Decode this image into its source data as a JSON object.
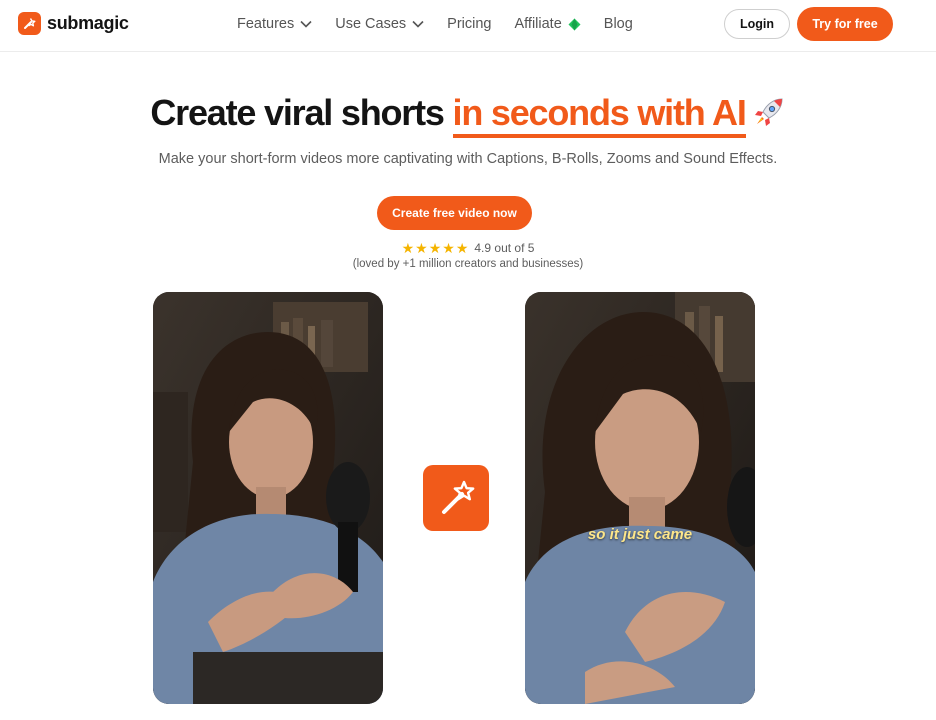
{
  "header": {
    "logo_text": "submagic",
    "nav": [
      {
        "label": "Features",
        "icon": "chevron-down-icon"
      },
      {
        "label": "Use Cases",
        "icon": "chevron-down-icon"
      },
      {
        "label": "Pricing"
      },
      {
        "label": "Affiliate",
        "icon": "gem-icon"
      },
      {
        "label": "Blog"
      }
    ],
    "login_label": "Login",
    "try_label": "Try for free"
  },
  "hero": {
    "title_part1": "Create viral shorts",
    "title_highlight": "in seconds with AI",
    "subtitle": "Make your short-form videos more captivating with Captions, B-Rolls, Zooms and Sound Effects.",
    "cta_label": "Create free video now",
    "rating_text": "4.9 out of 5",
    "rating_stars": 5,
    "rating_sub": "(loved by +1 million creators and businesses)"
  },
  "demo": {
    "caption_text": "so it just came"
  },
  "colors": {
    "accent": "#f15a1a",
    "star": "#f5b400",
    "caption": "#fde68a"
  }
}
